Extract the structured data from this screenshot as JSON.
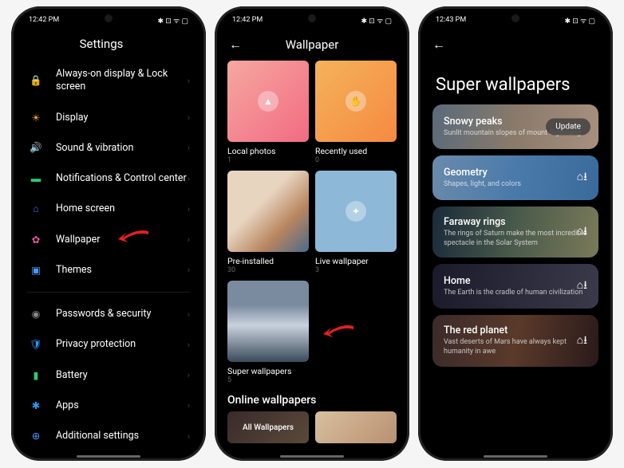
{
  "status": {
    "time1": "12:42 PM",
    "time2": "12:42 PM",
    "time3": "12:43 PM",
    "extra": "⇅ ∠",
    "icons": "✱ ⊡ ᯤ ▢"
  },
  "screen1": {
    "title": "Settings",
    "items": [
      {
        "label": "Always-on display & Lock screen",
        "icon": "🔒",
        "color": "#e65a2a"
      },
      {
        "label": "Display",
        "icon": "☀",
        "color": "#f5a623"
      },
      {
        "label": "Sound & vibration",
        "icon": "🔊",
        "color": "#2ecc71"
      },
      {
        "label": "Notifications & Control center",
        "icon": "▬",
        "color": "#2ecc71"
      },
      {
        "label": "Home screen",
        "icon": "⌂",
        "color": "#4a7aff"
      },
      {
        "label": "Wallpaper",
        "icon": "✿",
        "color": "#e65aa0"
      },
      {
        "label": "Themes",
        "icon": "▣",
        "color": "#4a9aff"
      }
    ],
    "items2": [
      {
        "label": "Passwords & security",
        "icon": "◉",
        "color": "#888"
      },
      {
        "label": "Privacy protection",
        "icon": "🛡",
        "color": "#2a9aff"
      },
      {
        "label": "Battery",
        "icon": "▮",
        "color": "#2ecc71"
      },
      {
        "label": "Apps",
        "icon": "✱",
        "color": "#2a9aff"
      },
      {
        "label": "Additional settings",
        "icon": "⊕",
        "color": "#4a9aff"
      }
    ]
  },
  "screen2": {
    "title": "Wallpaper",
    "tiles": [
      {
        "label": "Local photos",
        "count": "1",
        "cls": "thumb-local",
        "glyph": "▲"
      },
      {
        "label": "Recently used",
        "count": "0",
        "cls": "thumb-recent",
        "glyph": "✋"
      },
      {
        "label": "Pre-installed",
        "count": "30",
        "cls": "thumb-pre",
        "glyph": ""
      },
      {
        "label": "Live wallpaper",
        "count": "3",
        "cls": "thumb-live",
        "glyph": "✦"
      },
      {
        "label": "Super wallpapers",
        "count": "5",
        "cls": "thumb-super",
        "glyph": ""
      }
    ],
    "section": "Online wallpapers",
    "tab": "All Wallpapers"
  },
  "screen3": {
    "title": "Super wallpapers",
    "cards": [
      {
        "title": "Snowy peaks",
        "sub": "Sunlit mountain slopes of mount Siguniang",
        "cls": "c-snowy",
        "action": "update"
      },
      {
        "title": "Geometry",
        "sub": "Shapes, light, and colors",
        "cls": "c-geom",
        "action": "download"
      },
      {
        "title": "Faraway rings",
        "sub": "The rings of Saturn make the most incredible spectacle in the Solar System",
        "cls": "c-rings",
        "action": "download"
      },
      {
        "title": "Home",
        "sub": "The Earth is the cradle of human civilization",
        "cls": "c-home",
        "action": "download"
      },
      {
        "title": "The red planet",
        "sub": "Vast deserts of Mars have always kept humanity in awe",
        "cls": "c-mars",
        "action": "download"
      }
    ],
    "update": "Update"
  }
}
